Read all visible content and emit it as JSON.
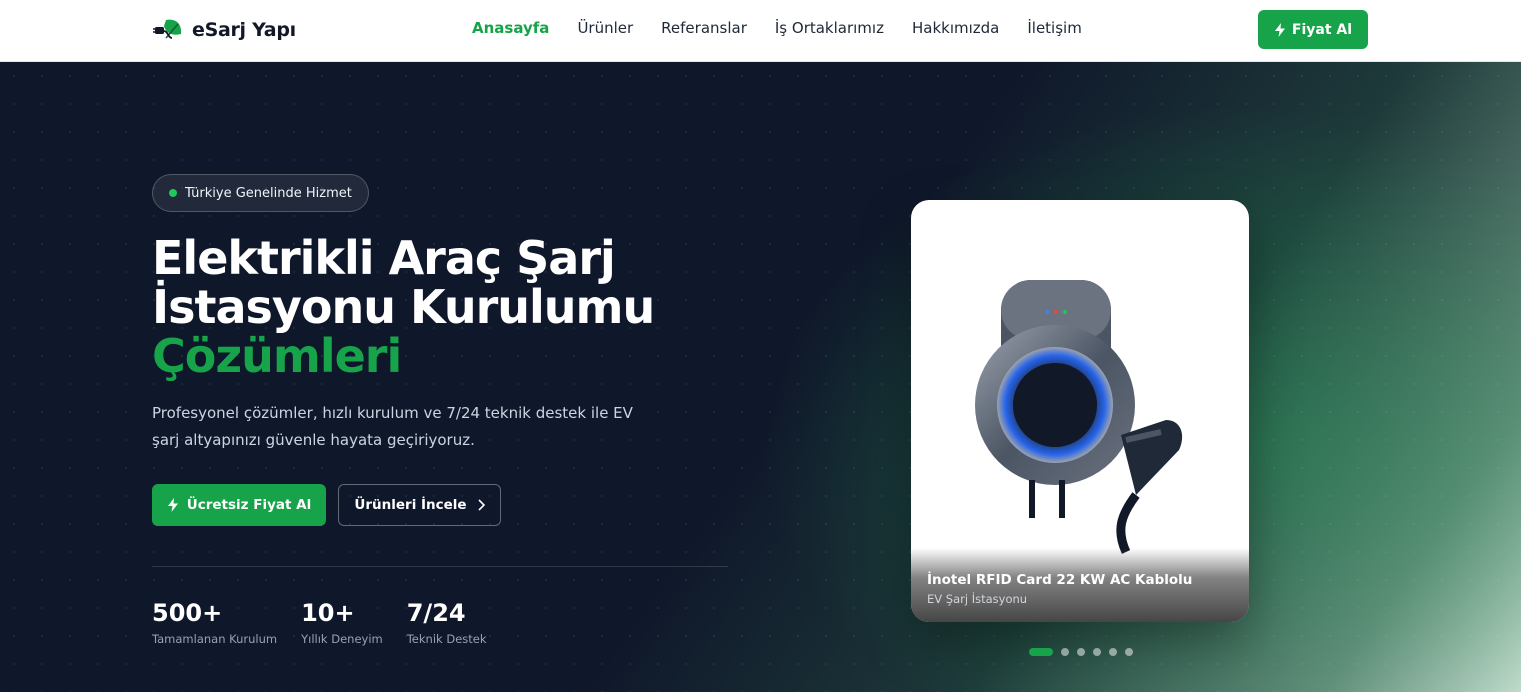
{
  "brand": {
    "name": "eSarj Yapı"
  },
  "nav": {
    "items": [
      "Anasayfa",
      "Ürünler",
      "Referanslar",
      "İş Ortaklarımız",
      "Hakkımızda",
      "İletişim"
    ],
    "active": "Anasayfa"
  },
  "header": {
    "cta_label": "Fiyat Al"
  },
  "hero": {
    "badge": "Türkiye Genelinde Hizmet",
    "title_line1": "Elektrikli Araç Şarj",
    "title_line2": "İstasyonu Kurulumu",
    "title_accent": "Çözümleri",
    "description": "Profesyonel çözümler, hızlı kurulum ve 7/24 teknik destek ile EV şarj altyapınızı güvenle hayata geçiriyoruz.",
    "primary_button": "Ücretsiz Fiyat Al",
    "secondary_button": "Ürünleri İncele",
    "stats": [
      {
        "value": "500+",
        "label": "Tamamlanan Kurulum"
      },
      {
        "value": "10+",
        "label": "Yıllık Deneyim"
      },
      {
        "value": "7/24",
        "label": "Teknik Destek"
      }
    ]
  },
  "product_card": {
    "title": "İnotel RFID Card 22 KW AC Kablolu",
    "subtitle": "EV Şarj İstasyonu"
  },
  "carousel": {
    "slide_count": 6,
    "active_index": 0
  },
  "colors": {
    "accent": "#16a34a",
    "background": "#0f172a",
    "header": "#ffffff"
  }
}
